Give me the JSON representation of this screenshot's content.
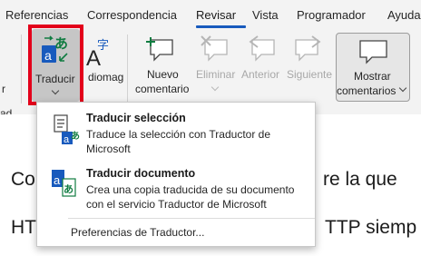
{
  "tabs": {
    "referencias": "Referencias",
    "correspondencia": "Correspondencia",
    "revisar": "Revisar",
    "vista": "Vista",
    "programador": "Programador",
    "ayuda": "Ayuda"
  },
  "ribbon": {
    "left_cut_label_1": "r",
    "left_cut_label_2": "ad",
    "left_cut_group": "ad",
    "translate_label": "Traducir",
    "language_label": "diomag",
    "language_label_visible": "diomag",
    "new_comment_line1": "Nuevo",
    "new_comment_line2": "comentario",
    "delete_label": "Eliminar",
    "previous_label": "Anterior",
    "next_label": "Siguiente",
    "show_comments_line1": "Mostrar",
    "show_comments_line2": "comentarios"
  },
  "menu": {
    "item1_title_underlined": "T",
    "item1_title_rest": "raducir selección",
    "item1_title": "Traducir selección",
    "item1_desc": "Traduce la selección con Traductor de Microsoft",
    "item2_title": "Traducir documento",
    "item2_desc": "Crea una copia traducida de su documento con el servicio Traductor de Microsoft",
    "prefs": "Preferencias de Traductor..."
  },
  "document": {
    "line1_left": "Co",
    "line1_right": "re la que",
    "line2_left": "HT",
    "line2_right": "TTP siemp"
  },
  "colors": {
    "ribbon_bg": "#f3f3f3",
    "active_tab_underline": "#185abd",
    "highlight_border": "#e3001b",
    "icon_green": "#107c41",
    "icon_blue": "#185abd"
  }
}
